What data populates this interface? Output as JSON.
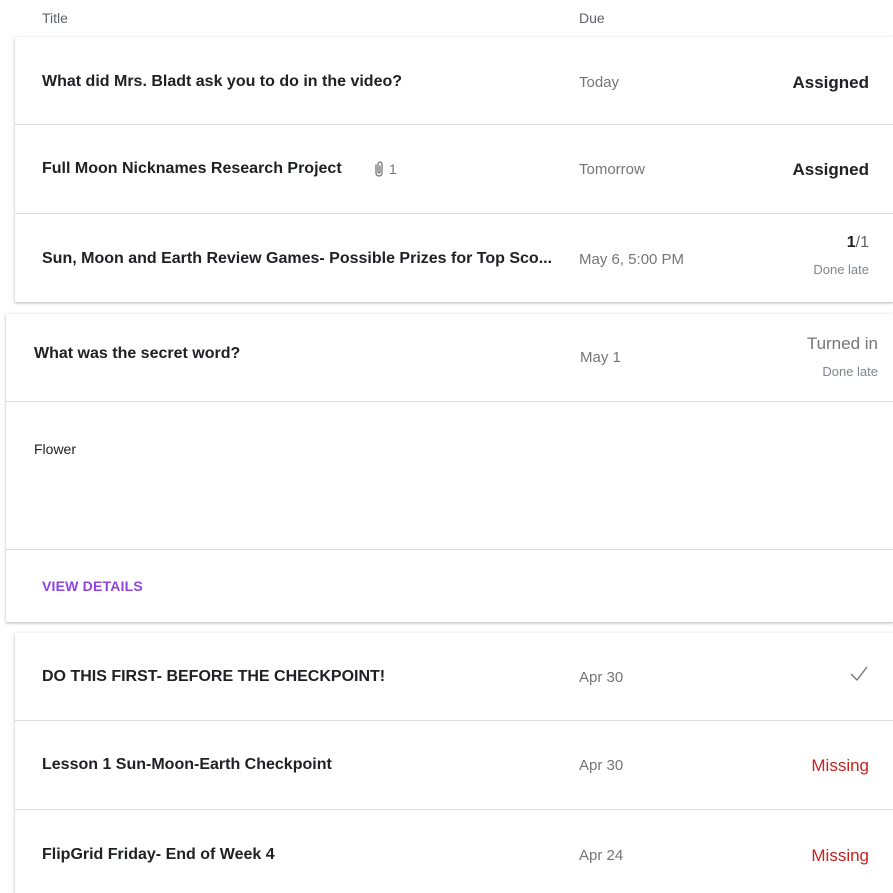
{
  "header": {
    "title_col": "Title",
    "due_col": "Due"
  },
  "assignments_top": [
    {
      "title": "What did Mrs. Bladt ask you to do in the video?",
      "due": "Today",
      "status": "Assigned"
    },
    {
      "title": "Full Moon Nicknames Research Project",
      "attachments": "1",
      "due": "Tomorrow",
      "status": "Assigned"
    },
    {
      "title": "Sun, Moon and Earth Review Games- Possible Prizes for Top Sco...",
      "due": "May 6, 5:00 PM",
      "grade_num": "1",
      "grade_den": "/1",
      "sub": "Done late"
    }
  ],
  "expanded": {
    "title": "What was the secret word?",
    "due": "May 1",
    "status": "Turned in",
    "sub": "Done late",
    "answer": "Flower",
    "link": "VIEW DETAILS"
  },
  "assignments_bottom": [
    {
      "title": "DO THIS FIRST- BEFORE THE CHECKPOINT!",
      "due": "Apr 30",
      "status_icon": "checkmark-icon"
    },
    {
      "title": "Lesson 1 Sun-Moon-Earth Checkpoint",
      "due": "Apr 30",
      "status": "Missing"
    },
    {
      "title": "FlipGrid Friday- End of Week 4",
      "due": "Apr 24",
      "status": "Missing"
    }
  ],
  "colors": {
    "missing": "#c5221f",
    "link": "#8e44e0",
    "divider": "#dadce0"
  }
}
